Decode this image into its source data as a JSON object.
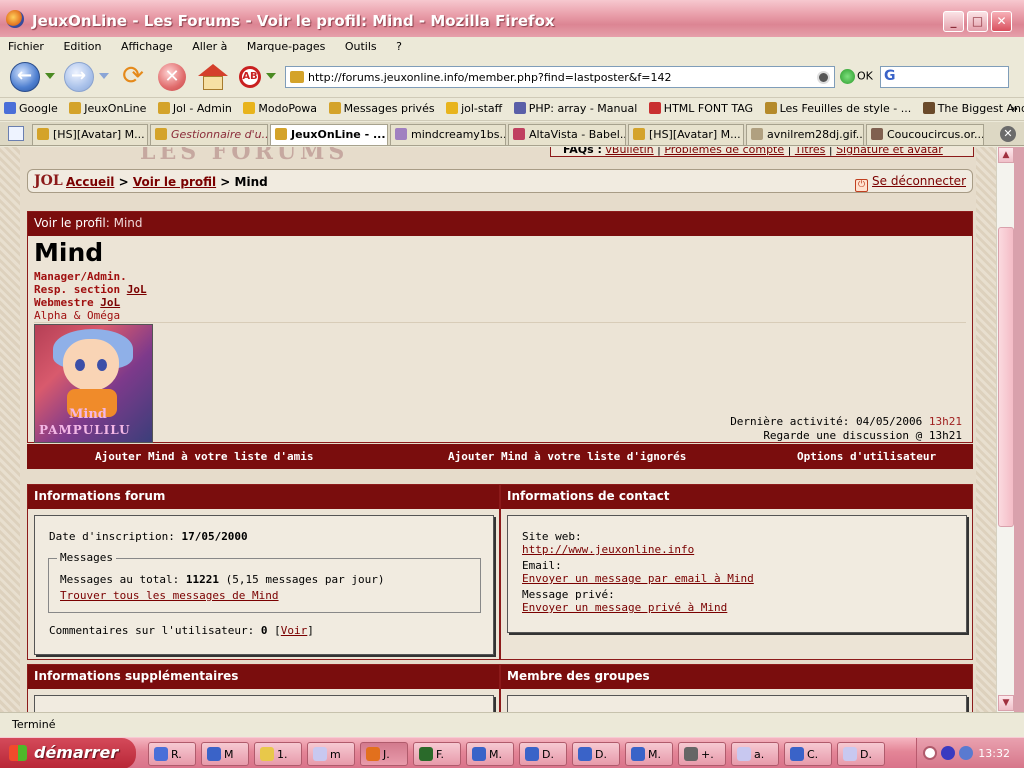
{
  "window": {
    "title": "JeuxOnLine - Les Forums - Voir le profil: Mind - Mozilla Firefox",
    "minimize": "_",
    "maximize": "□",
    "close": "✕"
  },
  "menu": [
    "Fichier",
    "Edition",
    "Affichage",
    "Aller à",
    "Marque-pages",
    "Outils",
    "?"
  ],
  "nav": {
    "url": "http://forums.jeuxonline.info/member.php?find=lastposter&f=142",
    "ok_label": "OK",
    "search_letter": "G"
  },
  "bookmarks": {
    "items": [
      {
        "label": "Google",
        "color": "#4a6fd8"
      },
      {
        "label": "JeuxOnLine",
        "color": "#d4a32a"
      },
      {
        "label": "Jol - Admin",
        "color": "#d4a32a"
      },
      {
        "label": "ModoPowa",
        "color": "#e8b41d"
      },
      {
        "label": "Messages privés",
        "color": "#d4a32a"
      },
      {
        "label": "jol-staff",
        "color": "#e8b41d"
      },
      {
        "label": "PHP: array - Manual",
        "color": "#5a5fa8"
      },
      {
        "label": "HTML FONT TAG",
        "color": "#c93030"
      },
      {
        "label": "Les Feuilles de style - ...",
        "color": "#b58a2a"
      },
      {
        "label": "The Biggest And Best ...",
        "color": "#6a4a2a"
      }
    ],
    "more": "»"
  },
  "tabs": [
    {
      "label": "[HS][Avatar] M...",
      "active": false,
      "italic": false
    },
    {
      "label": "Gestionnaire d'u...",
      "active": false,
      "italic": true
    },
    {
      "label": "JeuxOnLine - ...",
      "active": true,
      "italic": false
    },
    {
      "label": "mindcreamy1bs....",
      "active": false,
      "italic": false
    },
    {
      "label": "AltaVista - Babel...",
      "active": false,
      "italic": false
    },
    {
      "label": "[HS][Avatar] M...",
      "active": false,
      "italic": false
    },
    {
      "label": "avnilrem28dj.gif...",
      "active": false,
      "italic": false
    },
    {
      "label": "Coucoucircus.or...",
      "active": false,
      "italic": false
    }
  ],
  "page": {
    "top_logo": "LES FORUMS",
    "faqs": {
      "label": "FAQs :",
      "links": [
        "vBulletin",
        "Problèmes de compte",
        "Titres",
        "Signature et avatar"
      ]
    },
    "breadcrumb": {
      "logo": "JOL",
      "home": "Accueil",
      "sep1": " > ",
      "profile": "Voir le profil",
      "sep2": " > ",
      "current": "Mind",
      "logout": "Se déconnecter"
    },
    "profile": {
      "header_label": "Voir le profil",
      "header_value": ": Mind",
      "name": "Mind",
      "role1": "Manager/Admin.",
      "role2_text": "Resp. section ",
      "role2_link": "JoL",
      "role3_text": "Webmestre ",
      "role3_link": "JoL",
      "tagline": "Alpha & Oméga",
      "avatar_text1": "Mind",
      "avatar_text2": "PAMPULILU",
      "last_activity_label": "Dernière activité: 04/05/2006 ",
      "last_activity_time": "13h21",
      "last_action": "Regarde une discussion @ 13h21"
    },
    "actions": {
      "add_friend": "Ajouter Mind à votre liste d'amis",
      "add_ignore": "Ajouter Mind à votre liste d'ignorés",
      "user_options": "Options d'utilisateur"
    },
    "forum_info": {
      "title": "Informations forum",
      "join_label": "Date d'inscription: ",
      "join_value": "17/05/2000",
      "messages_legend": "Messages",
      "total_label": "Messages au total: ",
      "total_value": "11221",
      "per_day": " (5,15 messages par jour)",
      "find_all": "Trouver tous les messages de Mind",
      "comments_label": "Commentaires sur l'utilisateur: ",
      "comments_value": "0",
      "comments_open": " [",
      "comments_link": "Voir",
      "comments_close": "]"
    },
    "contact_info": {
      "title": "Informations de contact",
      "site_label": "Site web:",
      "site_link": "http://www.jeuxonline.info",
      "email_label": "Email:",
      "email_link": "Envoyer un message par email à Mind",
      "pm_label": "Message privé:",
      "pm_link": "Envoyer un message privé à Mind"
    },
    "extra_info": {
      "title": "Informations supplémentaires"
    },
    "groups": {
      "title": "Membre des groupes"
    }
  },
  "status": "Terminé",
  "taskbar": {
    "start": "démarrer",
    "buttons": [
      {
        "label": "R.",
        "color": "#4a6fd8",
        "active": false
      },
      {
        "label": "M",
        "color": "#3a63c8",
        "active": false
      },
      {
        "label": "1.",
        "color": "#e8c84a",
        "active": false
      },
      {
        "label": "m",
        "color": "#c8c8f0",
        "active": false
      },
      {
        "label": "J.",
        "color": "#e2701d",
        "active": true
      },
      {
        "label": "F.",
        "color": "#2a6a2a",
        "active": false
      },
      {
        "label": "M.",
        "color": "#3a63c8",
        "active": false
      },
      {
        "label": "D.",
        "color": "#3a63c8",
        "active": false
      },
      {
        "label": "D.",
        "color": "#3a63c8",
        "active": false
      },
      {
        "label": "M.",
        "color": "#3a63c8",
        "active": false
      },
      {
        "label": "+.",
        "color": "#666666",
        "active": false
      },
      {
        "label": "a.",
        "color": "#c8c8f0",
        "active": false
      },
      {
        "label": "C.",
        "color": "#3a63c8",
        "active": false
      },
      {
        "label": "D.",
        "color": "#c8c8f0",
        "active": false
      }
    ],
    "clock": "13:32"
  }
}
